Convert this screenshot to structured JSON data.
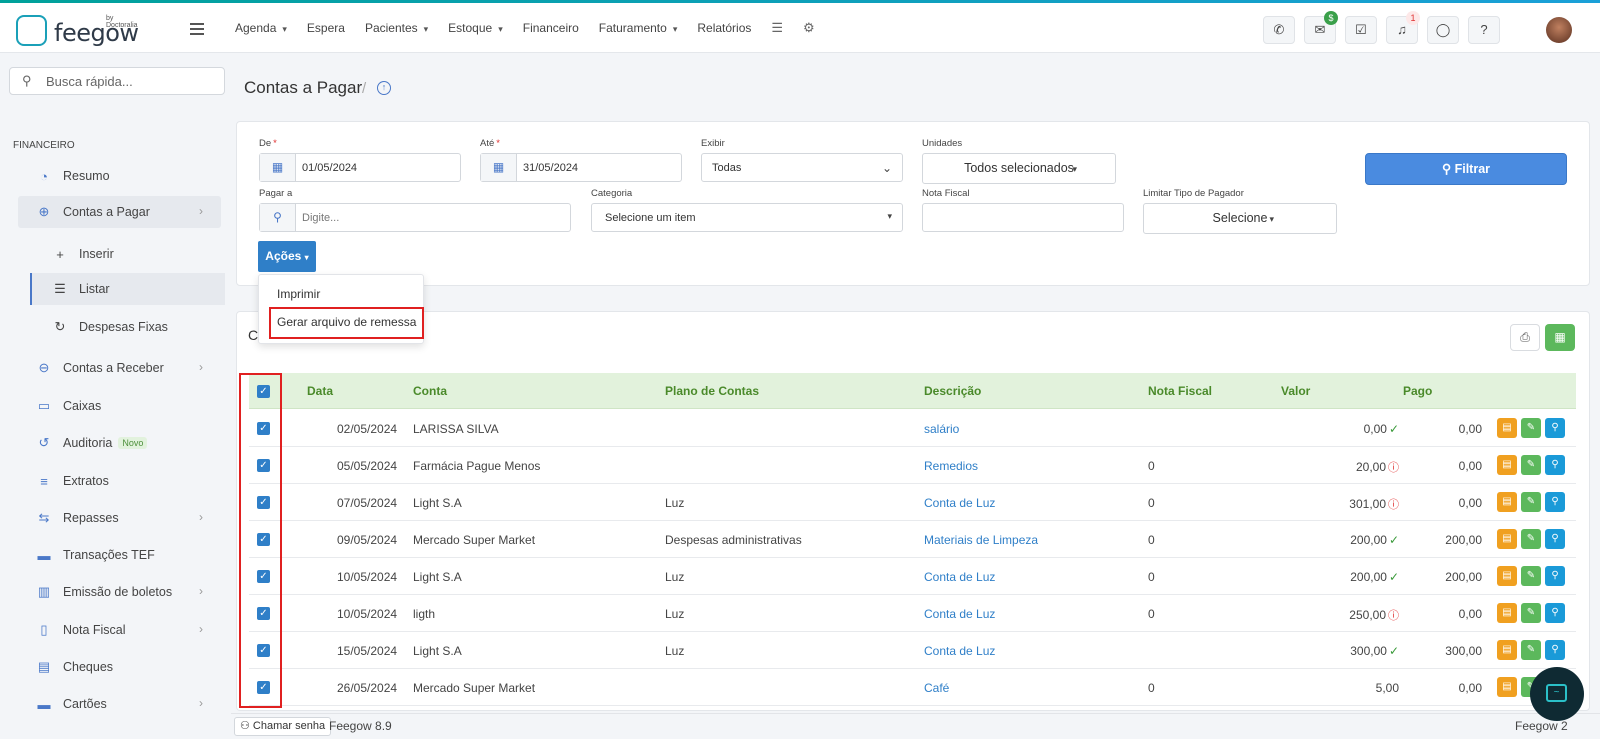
{
  "app": {
    "logo_text": "feegow",
    "logo_by": "by Doctoralia"
  },
  "nav": {
    "items": [
      {
        "label": "Agenda",
        "dropdown": true
      },
      {
        "label": "Espera",
        "dropdown": false
      },
      {
        "label": "Pacientes",
        "dropdown": true
      },
      {
        "label": "Estoque",
        "dropdown": true
      },
      {
        "label": "Financeiro",
        "dropdown": false
      },
      {
        "label": "Faturamento",
        "dropdown": true
      },
      {
        "label": "Relatórios",
        "dropdown": false
      }
    ],
    "icons": [
      "database-icon",
      "gear-icon"
    ],
    "right_badges": {
      "inbox": "$",
      "notifications": "1"
    }
  },
  "sidebar": {
    "search_placeholder": "Busca rápida...",
    "section": "FINANCEIRO",
    "items": {
      "resumo": "Resumo",
      "contas_pagar": "Contas a Pagar",
      "inserir": "Inserir",
      "listar": "Listar",
      "despesas_fixas": "Despesas Fixas",
      "contas_receber": "Contas a Receber",
      "caixas": "Caixas",
      "auditoria": "Auditoria",
      "auditoria_badge": "Novo",
      "extratos": "Extratos",
      "repasses": "Repasses",
      "transacoes": "Transações TEF",
      "boletos": "Emissão de boletos",
      "nota_fiscal": "Nota Fiscal",
      "cheques": "Cheques",
      "cartoes": "Cartões"
    }
  },
  "page": {
    "title": "Contas a Pagar",
    "crumb_sep": "/"
  },
  "filters": {
    "de_label": "De",
    "de_value": "01/05/2024",
    "ate_label": "Até",
    "ate_value": "31/05/2024",
    "req_mark": "*",
    "exibir_label": "Exibir",
    "exibir_value": "Todas",
    "unidades_label": "Unidades",
    "unidades_value": "Todos selecionados",
    "filtrar_label": "Filtrar",
    "pagar_a_label": "Pagar a",
    "pagar_a_placeholder": "Digite...",
    "categoria_label": "Categoria",
    "categoria_value": "Selecione um item",
    "nota_fiscal_label": "Nota Fiscal",
    "nota_fiscal_value": "",
    "limitar_label": "Limitar Tipo de Pagador",
    "limitar_value": "Selecione"
  },
  "actions": {
    "button_label": "Ações",
    "menu": [
      "Imprimir",
      "Gerar arquivo de remessa"
    ]
  },
  "table": {
    "title": "Contas",
    "headers": [
      "Data",
      "Conta",
      "Plano de Contas",
      "Descrição",
      "Nota Fiscal",
      "Valor",
      "Pago"
    ],
    "rows": [
      {
        "data": "02/05/2024",
        "conta": "LARISSA SILVA",
        "plano": "",
        "descricao": "salário",
        "nf": "",
        "valor": "0,00",
        "status": "ok",
        "pago": "0,00"
      },
      {
        "data": "05/05/2024",
        "conta": "Farmácia Pague Menos",
        "plano": "",
        "descricao": "Remedios",
        "nf": "0",
        "valor": "20,00",
        "status": "warn",
        "pago": "0,00"
      },
      {
        "data": "07/05/2024",
        "conta": "Light S.A",
        "plano": "Luz",
        "descricao": "Conta de Luz",
        "nf": "0",
        "valor": "301,00",
        "status": "warn",
        "pago": "0,00"
      },
      {
        "data": "09/05/2024",
        "conta": "Mercado Super Market",
        "plano": "Despesas administrativas",
        "descricao": "Materiais de Limpeza",
        "nf": "0",
        "valor": "200,00",
        "status": "ok",
        "pago": "200,00"
      },
      {
        "data": "10/05/2024",
        "conta": "Light S.A",
        "plano": "Luz",
        "descricao": "Conta de Luz",
        "nf": "0",
        "valor": "200,00",
        "status": "ok",
        "pago": "200,00"
      },
      {
        "data": "10/05/2024",
        "conta": "ligth",
        "plano": "Luz",
        "descricao": "Conta de Luz",
        "nf": "0",
        "valor": "250,00",
        "status": "warn",
        "pago": "0,00"
      },
      {
        "data": "15/05/2024",
        "conta": "Light S.A",
        "plano": "Luz",
        "descricao": "Conta de Luz",
        "nf": "",
        "valor": "300,00",
        "status": "ok",
        "pago": "300,00"
      },
      {
        "data": "26/05/2024",
        "conta": "Mercado Super Market",
        "plano": "",
        "descricao": "Café",
        "nf": "0",
        "valor": "5,00",
        "status": "",
        "pago": "0,00"
      }
    ]
  },
  "footer": {
    "chamar": "Chamar senha",
    "version": "Feegow 8.9",
    "version_right": "Feegow 2"
  },
  "colors": {
    "accent": "#2f7fc8",
    "filtrar": "#4a8be0",
    "table_header_bg": "#e2f2dc",
    "table_header_text": "#4a8a2a",
    "highlight": "#e02020"
  }
}
